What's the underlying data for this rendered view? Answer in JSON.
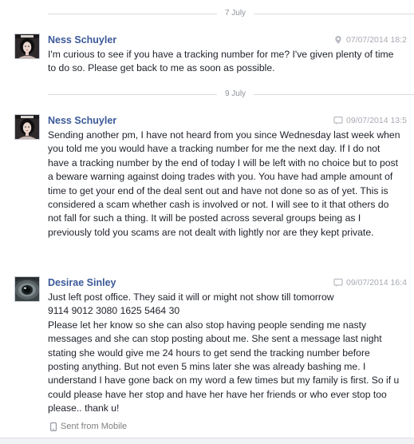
{
  "thread": {
    "separators": [
      {
        "label": "7 July"
      },
      {
        "label": "9 July"
      }
    ],
    "messages": [
      {
        "sender": "Ness Schuyler",
        "timestamp": "07/07/2014 18:2",
        "meta_icon": "location-pin-icon",
        "paragraphs": [
          "I'm curious to see if you have a tracking number for me? I've given plenty of time to do so. Please get back to me as soon as possible."
        ]
      },
      {
        "sender": "Ness Schuyler",
        "timestamp": "09/07/2014 13:5",
        "meta_icon": "chat-bubble-icon",
        "paragraphs": [
          "Sending another pm,  I have not heard from you since Wednesday last week when you told me you would have a tracking number for me the next day. If I do not have a tracking number by the end of today I will be left with no choice but to post a beware warning against doing trades with you. You have had ample amount of time to get your end of the deal sent out and have not done so as of yet. This is considered a scam whether cash is involved or not. I will see to it that others do not fall for such a thing. It will be posted across several groups being as I previously told you scams are not dealt with lightly nor are they kept private."
        ]
      },
      {
        "sender": "Desirae Sinley",
        "timestamp": "09/07/2014 16:4",
        "meta_icon": "chat-bubble-icon",
        "paragraphs": [
          "Just left post office. They said it will or might not show till tomorrow",
          "9114 9012 3080 1625 5464 30",
          "Please let her know so she can also stop having people sending me nasty messages and she can stop posting about me. She sent a message last night stating she would give me 24 hours to get send the tracking number before posting anything. But not even 5 mins later she was already bashing me. I understand I have gone back on my word a few times but my family is first. So if u could please have her stop and have her have her friends or who ever stop too please.. thank u!"
        ],
        "footer": "Sent from Mobile",
        "footer_icon": "mobile-phone-icon"
      }
    ]
  }
}
